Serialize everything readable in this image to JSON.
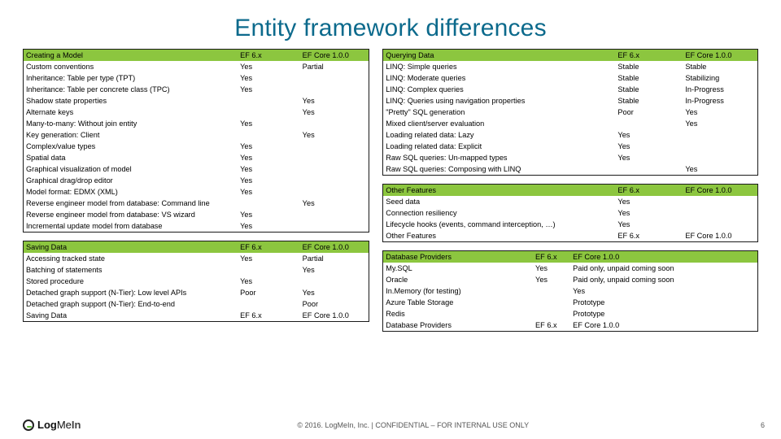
{
  "title": "Entity framework differences",
  "footer": {
    "logo_text": "LogMeIn",
    "copyright": "© 2016. LogMeIn, Inc. | CONFIDENTIAL – FOR INTERNAL USE ONLY",
    "page_number": "6"
  },
  "tables": {
    "creating_model": {
      "header": [
        "Creating a Model",
        "EF 6.x",
        "EF Core 1.0.0"
      ],
      "rows": [
        [
          "Custom conventions",
          "Yes",
          "Partial"
        ],
        [
          "Inheritance: Table per type (TPT)",
          "Yes",
          ""
        ],
        [
          "Inheritance: Table per concrete class (TPC)",
          "Yes",
          ""
        ],
        [
          "Shadow state properties",
          "",
          "Yes"
        ],
        [
          "Alternate keys",
          "",
          "Yes"
        ],
        [
          "Many-to-many: Without join entity",
          "Yes",
          ""
        ],
        [
          "Key generation: Client",
          "",
          "Yes"
        ],
        [
          "Complex/value types",
          "Yes",
          ""
        ],
        [
          "Spatial data",
          "Yes",
          ""
        ],
        [
          "Graphical visualization of model",
          "Yes",
          ""
        ],
        [
          "Graphical drag/drop editor",
          "Yes",
          ""
        ],
        [
          "Model format: EDMX (XML)",
          "Yes",
          ""
        ],
        [
          "Reverse engineer model from database: Command line",
          "",
          "Yes"
        ],
        [
          "Reverse engineer model from database: VS wizard",
          "Yes",
          ""
        ],
        [
          "Incremental update model from database",
          "Yes",
          ""
        ]
      ]
    },
    "saving_data": {
      "header": [
        "Saving Data",
        "EF 6.x",
        "EF Core 1.0.0"
      ],
      "rows": [
        [
          "Accessing tracked state",
          "Yes",
          "Partial"
        ],
        [
          "Batching of statements",
          "",
          "Yes"
        ],
        [
          "Stored procedure",
          "Yes",
          ""
        ],
        [
          "Detached graph support (N-Tier): Low level APIs",
          "Poor",
          "Yes"
        ],
        [
          "Detached graph support (N-Tier): End-to-end",
          "",
          "Poor"
        ],
        [
          "Saving Data",
          "EF 6.x",
          "EF Core 1.0.0"
        ]
      ]
    },
    "querying_data": {
      "header": [
        "Querying Data",
        "EF 6.x",
        "EF Core 1.0.0"
      ],
      "rows": [
        [
          "LINQ: Simple queries",
          "Stable",
          "Stable"
        ],
        [
          "LINQ: Moderate queries",
          "Stable",
          "Stabilizing"
        ],
        [
          "LINQ: Complex queries",
          "Stable",
          "In-Progress"
        ],
        [
          "LINQ: Queries using navigation properties",
          "Stable",
          "In-Progress"
        ],
        [
          "\"Pretty\" SQL generation",
          "Poor",
          "Yes"
        ],
        [
          "Mixed client/server evaluation",
          "",
          "Yes"
        ],
        [
          "Loading related data: Lazy",
          "Yes",
          ""
        ],
        [
          "Loading related data: Explicit",
          "Yes",
          ""
        ],
        [
          "Raw SQL queries: Un-mapped types",
          "Yes",
          ""
        ],
        [
          "Raw SQL queries: Composing with LINQ",
          "",
          "Yes"
        ]
      ]
    },
    "other_features": {
      "header": [
        "Other Features",
        "EF 6.x",
        "EF Core 1.0.0"
      ],
      "rows": [
        [
          "Seed data",
          "Yes",
          ""
        ],
        [
          "Connection resiliency",
          "Yes",
          ""
        ],
        [
          "Lifecycle hooks (events, command interception, …)",
          "Yes",
          ""
        ],
        [
          "Other Features",
          "EF 6.x",
          "EF Core 1.0.0"
        ]
      ]
    },
    "database_providers": {
      "header": [
        "Database Providers",
        "EF 6.x",
        "EF Core 1.0.0"
      ],
      "rows": [
        [
          "My.SQL",
          "Yes",
          "Paid only, unpaid coming soon"
        ],
        [
          "Oracle",
          "Yes",
          "Paid only, unpaid coming soon"
        ],
        [
          "In.Memory (for testing)",
          "",
          "Yes"
        ],
        [
          "Azure Table Storage",
          "",
          "Prototype"
        ],
        [
          "Redis",
          "",
          "Prototype"
        ],
        [
          "Database Providers",
          "EF 6.x",
          "EF Core 1.0.0"
        ]
      ]
    }
  }
}
